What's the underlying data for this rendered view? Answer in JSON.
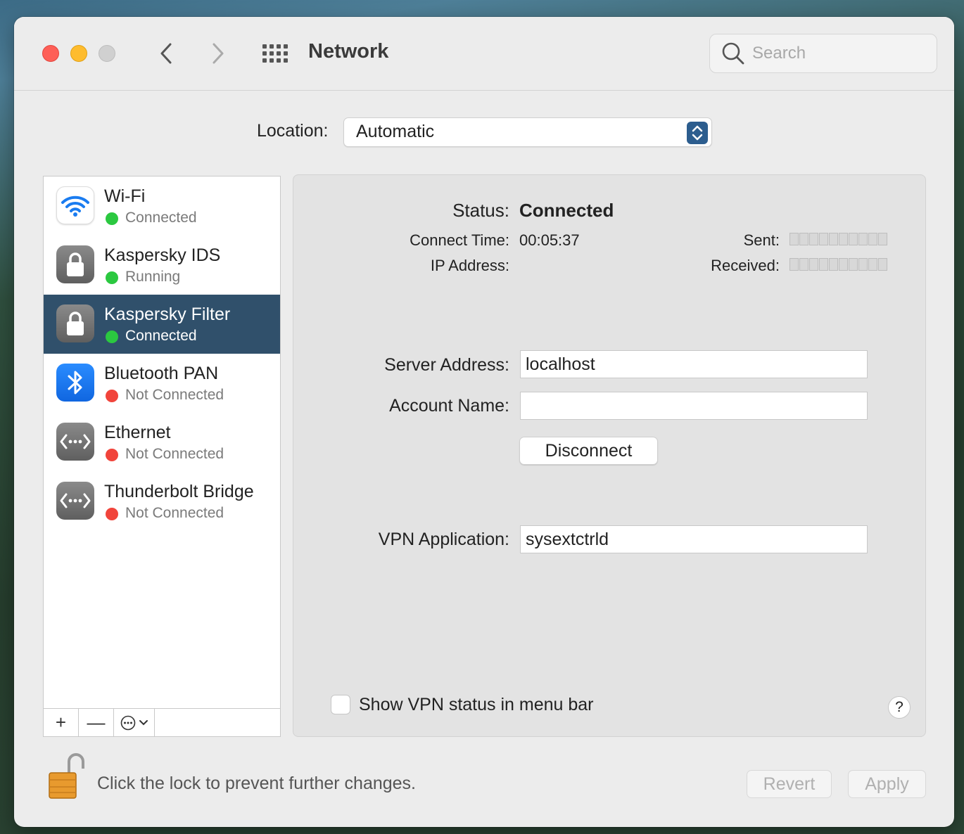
{
  "window": {
    "title": "Network"
  },
  "search": {
    "placeholder": "Search"
  },
  "location": {
    "label": "Location:",
    "value": "Automatic"
  },
  "services": [
    {
      "name": "Wi-Fi",
      "status": "Connected",
      "status_color": "#2bc840",
      "icon": "wifi-icon"
    },
    {
      "name": "Kaspersky IDS",
      "status": "Running",
      "status_color": "#2bc840",
      "icon": "lock-icon"
    },
    {
      "name": "Kaspersky Filter",
      "status": "Connected",
      "status_color": "#2bc840",
      "icon": "lock-icon",
      "selected": true
    },
    {
      "name": "Bluetooth PAN",
      "status": "Not Connected",
      "status_color": "#f1443b",
      "icon": "bluetooth-icon"
    },
    {
      "name": "Ethernet",
      "status": "Not Connected",
      "status_color": "#f1443b",
      "icon": "ethernet-icon"
    },
    {
      "name": "Thunderbolt Bridge",
      "status": "Not Connected",
      "status_color": "#f1443b",
      "icon": "ethernet-icon"
    }
  ],
  "sidebar_toolbar": {
    "add": "+",
    "remove": "—"
  },
  "detail": {
    "status_label": "Status:",
    "status_value": "Connected",
    "connect_time_label": "Connect Time:",
    "connect_time_value": "00:05:37",
    "ip_label": "IP Address:",
    "sent_label": "Sent:",
    "received_label": "Received:",
    "server_address_label": "Server Address:",
    "server_address_value": "localhost",
    "account_name_label": "Account Name:",
    "account_name_value": "",
    "disconnect_label": "Disconnect",
    "vpn_app_label": "VPN Application:",
    "vpn_app_value": "sysextctrld",
    "show_vpn_label": "Show VPN status in menu bar",
    "show_vpn_checked": false,
    "help_label": "?"
  },
  "footer": {
    "lock_text": "Click the lock to prevent further changes.",
    "revert_label": "Revert",
    "apply_label": "Apply"
  },
  "colors": {
    "accent": "#30506b",
    "connected": "#2bc840",
    "not_connected": "#f1443b"
  }
}
